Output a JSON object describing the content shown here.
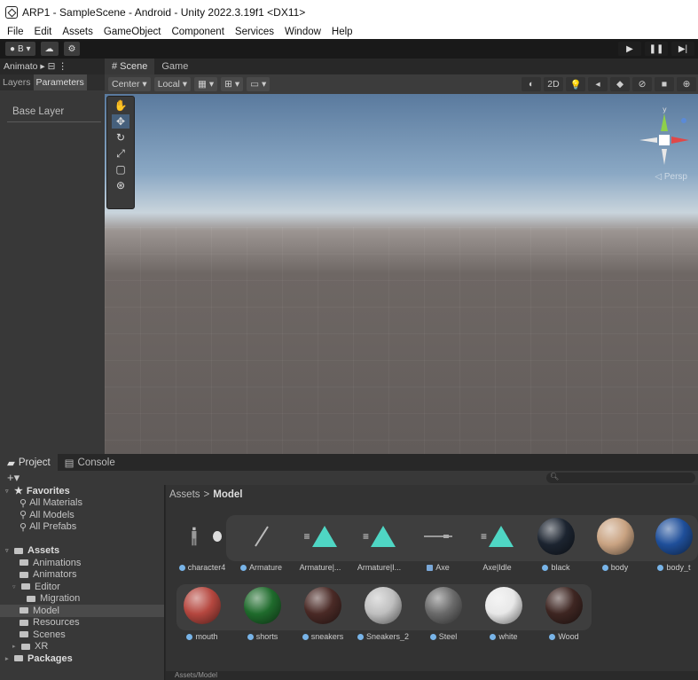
{
  "window": {
    "title": "ARP1 - SampleScene - Android - Unity 2022.3.19f1 <DX11>"
  },
  "menu": [
    "File",
    "Edit",
    "Assets",
    "GameObject",
    "Component",
    "Services",
    "Window",
    "Help"
  ],
  "toolbar": {
    "account_label": "B ▾"
  },
  "animator": {
    "tab_label": "Animato ▸ ⊟ ⋮",
    "subtabs": [
      "Layers",
      "Parameters"
    ],
    "base_layer": "Base Layer"
  },
  "scene_tabs": [
    "# Scene",
    "Game"
  ],
  "scene_toolbar": {
    "pivot": "Center ▾",
    "space": "Local ▾",
    "mode_2d": "2D"
  },
  "bottom_tabs": [
    "Project",
    "Console"
  ],
  "project": {
    "tree": [
      {
        "label": "Favorites",
        "bold": true,
        "indent": 0,
        "arrow": "▿",
        "star": true
      },
      {
        "label": "All Materials",
        "indent": 2,
        "search": true
      },
      {
        "label": "All Models",
        "indent": 2,
        "search": true
      },
      {
        "label": "All Prefabs",
        "indent": 2,
        "search": true
      },
      {
        "label": "",
        "indent": 0
      },
      {
        "label": "Assets",
        "bold": true,
        "indent": 0,
        "arrow": "▿",
        "folder": true
      },
      {
        "label": "Animations",
        "indent": 2,
        "folder": true
      },
      {
        "label": "Animators",
        "indent": 2,
        "folder": true
      },
      {
        "label": "Editor",
        "indent": 1,
        "arrow": "▿",
        "folder": true
      },
      {
        "label": "Migration",
        "indent": 3,
        "folder": true
      },
      {
        "label": "Model",
        "indent": 2,
        "folder": true,
        "selected": true
      },
      {
        "label": "Resources",
        "indent": 2,
        "folder": true
      },
      {
        "label": "Scenes",
        "indent": 2,
        "folder": true
      },
      {
        "label": "XR",
        "indent": 1,
        "arrow": "▸",
        "folder": true
      },
      {
        "label": "Packages",
        "bold": true,
        "indent": 0,
        "arrow": "▸",
        "folder": true
      }
    ],
    "breadcrumb": {
      "root": "Assets",
      "sep": ">",
      "current": "Model"
    },
    "row1": [
      {
        "name": "character4",
        "kind": "prefab"
      },
      {
        "name": "Armature",
        "kind": "prefab"
      },
      {
        "name": "Armature|...",
        "kind": "anim"
      },
      {
        "name": "Armature|I...",
        "kind": "anim"
      },
      {
        "name": "Axe",
        "kind": "mesh"
      },
      {
        "name": "Axe|Idle",
        "kind": "anim"
      },
      {
        "name": "black",
        "kind": "mat",
        "color": "#1c2430"
      },
      {
        "name": "body",
        "kind": "mat",
        "color": "#c9a382"
      },
      {
        "name": "body_t",
        "kind": "mat",
        "color": "#1f4f9a"
      }
    ],
    "row2": [
      {
        "name": "mouth",
        "kind": "mat",
        "color": "#b5473f"
      },
      {
        "name": "shorts",
        "kind": "mat",
        "color": "#1f6b2c"
      },
      {
        "name": "sneakers",
        "kind": "mat",
        "color": "#4a2a26"
      },
      {
        "name": "Sneakers_2",
        "kind": "mat",
        "color": "#bfbfbf"
      },
      {
        "name": "Steel",
        "kind": "mat",
        "color": "#6a6a6a"
      },
      {
        "name": "white",
        "kind": "mat",
        "color": "#e8e8e8"
      },
      {
        "name": "Wood",
        "kind": "mat",
        "color": "#3e2622"
      }
    ],
    "footer_path": "Assets/Model"
  }
}
